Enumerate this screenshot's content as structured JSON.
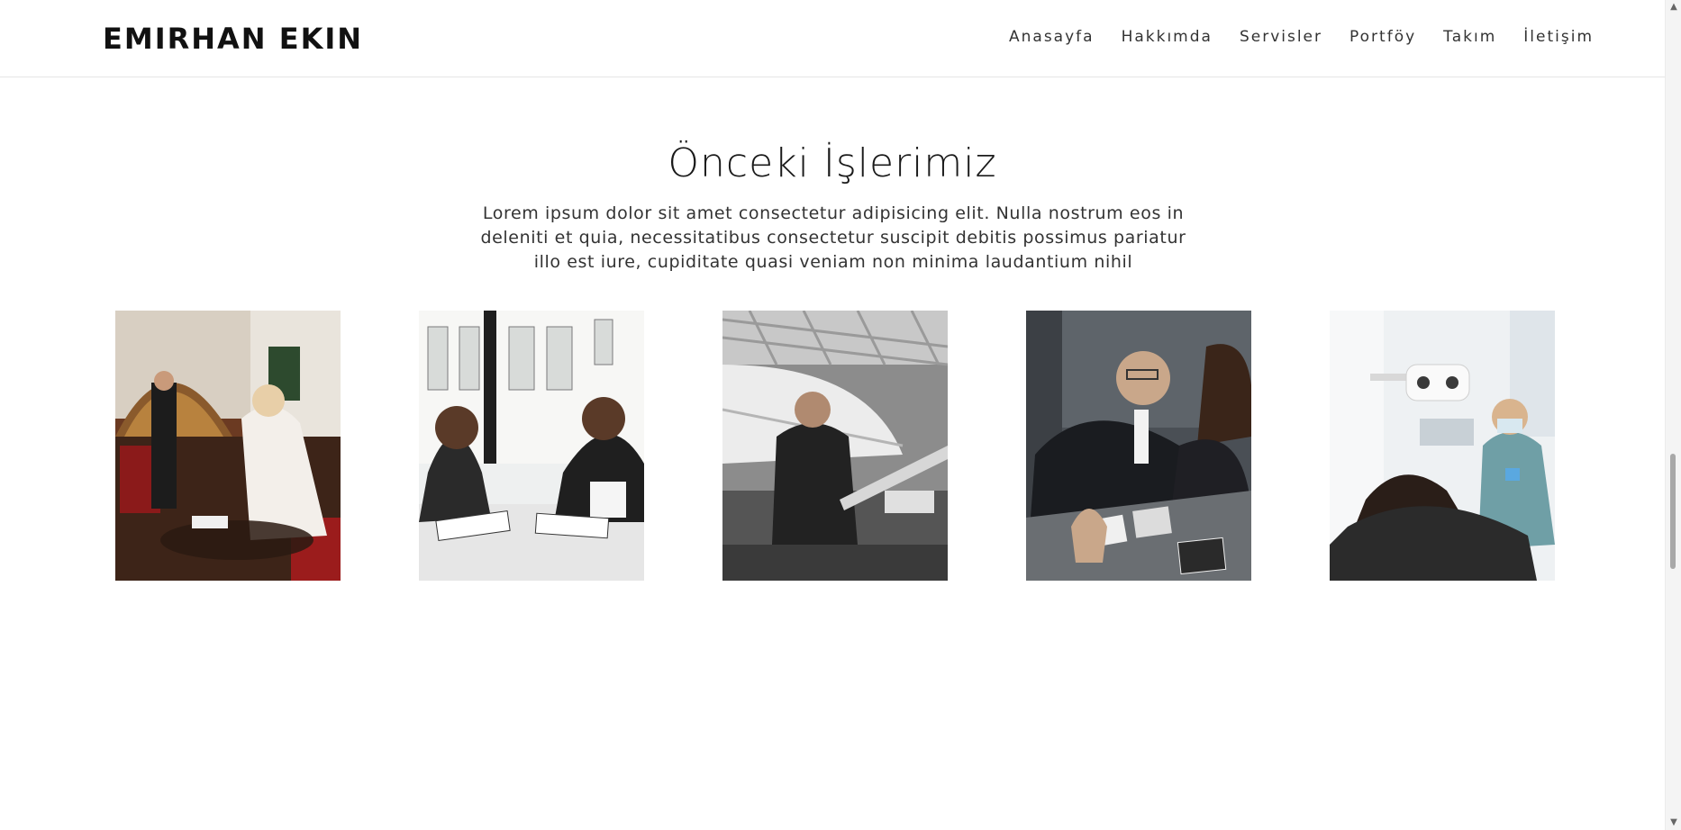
{
  "brand": {
    "name": "EMIRHAN EKIN"
  },
  "nav": {
    "items": [
      {
        "label": "Anasayfa"
      },
      {
        "label": "Hakkımda"
      },
      {
        "label": "Servisler"
      },
      {
        "label": "Portföy"
      },
      {
        "label": "Takım"
      },
      {
        "label": "İletişim"
      }
    ]
  },
  "portfolio": {
    "title": "Önceki İşlerimiz",
    "description": "Lorem ipsum dolor sit amet consectetur adipisicing elit. Nulla nostrum eos in deleniti et quia, necessitatibus consectetur suscipit debitis possimus pariatur illo est iure, cupiditate quasi veniam non minima laudantium nihil",
    "items": [
      {
        "image": "restaurant-cleaning-photo"
      },
      {
        "image": "office-meeting-photo"
      },
      {
        "image": "boat-workshop-photo"
      },
      {
        "image": "business-documents-photo"
      },
      {
        "image": "dental-clinic-photo"
      }
    ]
  },
  "scrollbar": {
    "up_icon": "▲",
    "down_icon": "▼"
  }
}
